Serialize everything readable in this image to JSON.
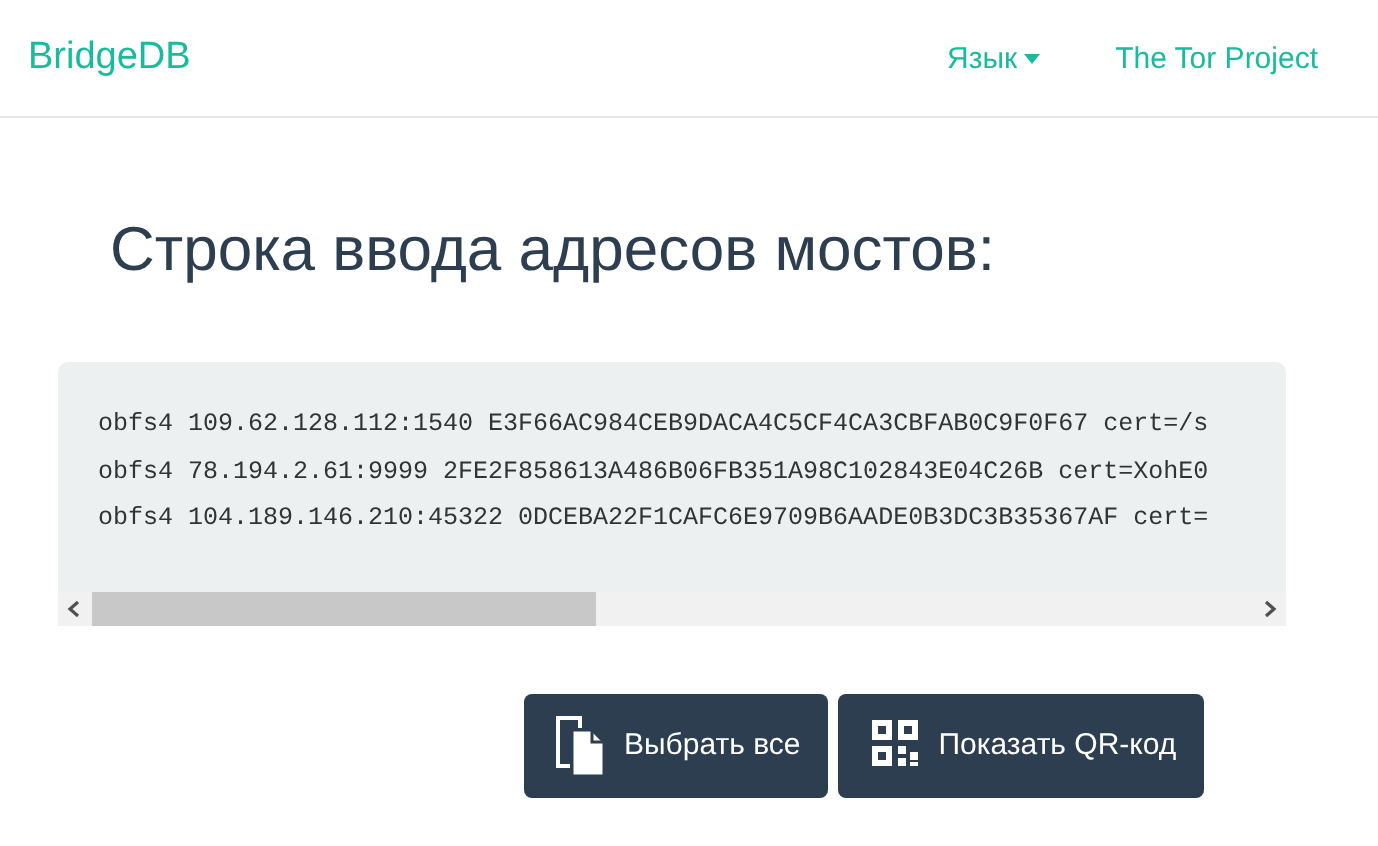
{
  "navbar": {
    "brand": "BridgeDB",
    "links": [
      {
        "label": "Язык",
        "kind": "dropdown"
      },
      {
        "label": "The Tor Project",
        "kind": "link"
      }
    ]
  },
  "heading": "Строка ввода адресов мостов:",
  "bridge_lines": [
    "obfs4 109.62.128.112:1540 E3F66AC984CEB9DACA4C5CF4CA3CBFAB0C9F0F67 cert=/s",
    "obfs4 78.194.2.61:9999 2FE2F858613A486B06FB351A98C102843E04C26B cert=XohE0",
    "obfs4 104.189.146.210:45322 0DCEBA22F1CAFC6E9709B6AADE0B3DC3B35367AF cert="
  ],
  "buttons": [
    {
      "label": "Выбрать все",
      "kind": "select"
    },
    {
      "label": "Показать QR-код",
      "kind": "qr"
    }
  ]
}
